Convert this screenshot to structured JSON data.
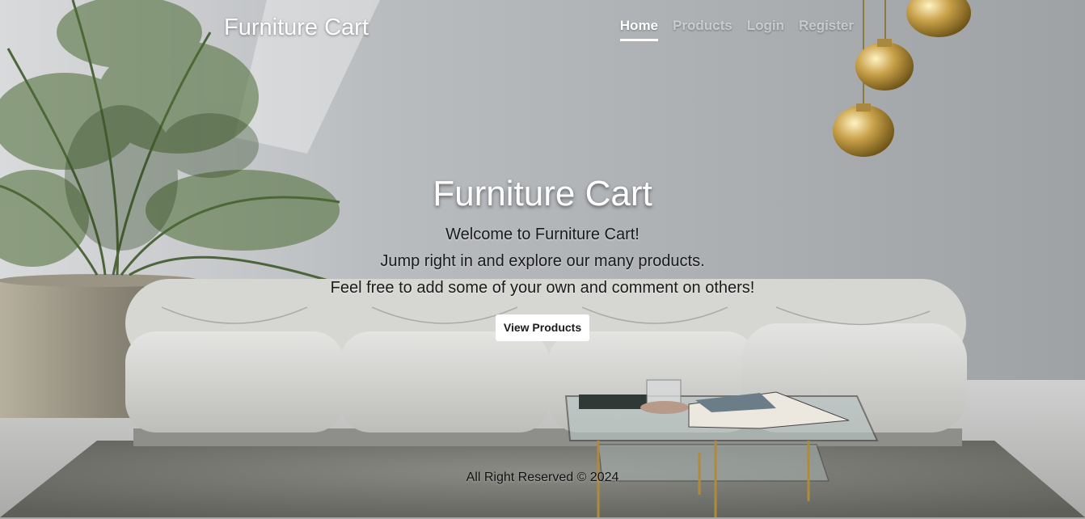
{
  "navbar": {
    "brand": "Furniture Cart",
    "links": [
      {
        "label": "Home",
        "active": true
      },
      {
        "label": "Products",
        "active": false
      },
      {
        "label": "Login",
        "active": false
      },
      {
        "label": "Register",
        "active": false
      }
    ]
  },
  "hero": {
    "title": "Furniture Cart",
    "lines": [
      "Welcome to Furniture Cart!",
      "Jump right in and explore our many products.",
      "Feel free to add some of your own and comment on others!"
    ],
    "button_label": "View Products"
  },
  "footer": {
    "text": "All Right Reserved © 2024"
  }
}
